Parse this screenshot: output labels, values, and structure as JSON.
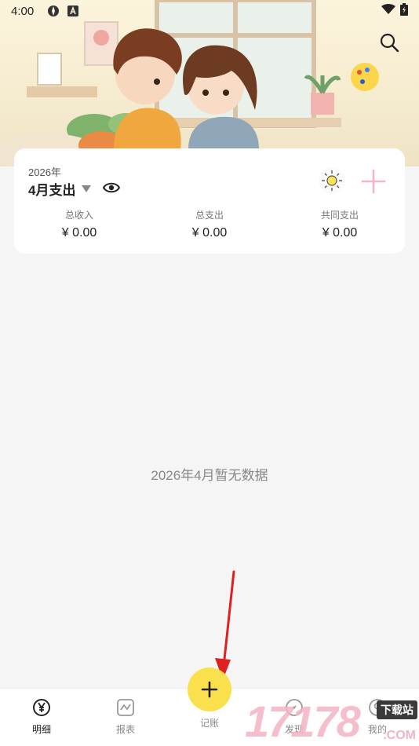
{
  "status": {
    "time": "4:00"
  },
  "card": {
    "year": "2026年",
    "month_title": "4月支出",
    "stats": [
      {
        "label": "总收入",
        "value": "¥ 0.00"
      },
      {
        "label": "总支出",
        "value": "¥ 0.00"
      },
      {
        "label": "共同支出",
        "value": "¥ 0.00"
      }
    ]
  },
  "empty": {
    "message": "2026年4月暂无数据"
  },
  "tabs": [
    {
      "label": "明细",
      "icon": "yen-circle-icon",
      "active": true
    },
    {
      "label": "报表",
      "icon": "chart-icon",
      "active": false
    },
    {
      "label": "记账",
      "icon": "plus-icon",
      "active": false
    },
    {
      "label": "发现",
      "icon": "compass-icon",
      "active": false
    },
    {
      "label": "我的",
      "icon": "user-icon",
      "active": false
    }
  ],
  "watermark": {
    "digits": "17178",
    "badge": "下载站",
    "suffix": ".COM"
  },
  "colors": {
    "fab": "#fbe04e",
    "accent_pink": "#f4b6c6",
    "arrow": "#e02020"
  }
}
